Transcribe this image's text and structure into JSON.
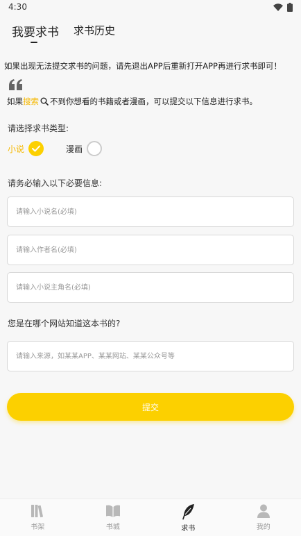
{
  "status_bar": {
    "time": "4:30"
  },
  "tabs": [
    {
      "label": "我要求书",
      "active": true
    },
    {
      "label": "求书历史",
      "active": false
    }
  ],
  "notice": "如果出现无法提交求书的问题，请先退出APP后重新打开APP再进行求书即可！",
  "hint": {
    "prefix": "如果",
    "highlight": "搜索",
    "suffix": "不到你想看的书籍或者漫画，可以提交以下信息进行求书。"
  },
  "type_section": {
    "label": "请选择求书类型:",
    "options": [
      {
        "label": "小说",
        "selected": true
      },
      {
        "label": "漫画",
        "selected": false
      }
    ]
  },
  "required_label": "请务必输入以下必要信息:",
  "fields": {
    "novel_name": {
      "value": "",
      "placeholder": "请输入小说名(必填)"
    },
    "author_name": {
      "value": "",
      "placeholder": "请输入作者名(必填)"
    },
    "protagonist_name": {
      "value": "",
      "placeholder": "请输入小说主角名(必填)"
    }
  },
  "source_section": {
    "label": "您是在哪个网站知道这本书的?",
    "placeholder": "请输入来源，如某某APP、某某网站、某某公众号等",
    "value": ""
  },
  "submit_label": "提交",
  "bottom_nav": [
    {
      "label": "书架",
      "icon": "bookshelf-icon",
      "active": false
    },
    {
      "label": "书城",
      "icon": "open-book-icon",
      "active": false
    },
    {
      "label": "求书",
      "icon": "feather-icon",
      "active": true
    },
    {
      "label": "我的",
      "icon": "person-icon",
      "active": false
    }
  ],
  "colors": {
    "accent": "#fcd000",
    "highlight_text": "#f5b800",
    "background": "#f7f7f7"
  }
}
